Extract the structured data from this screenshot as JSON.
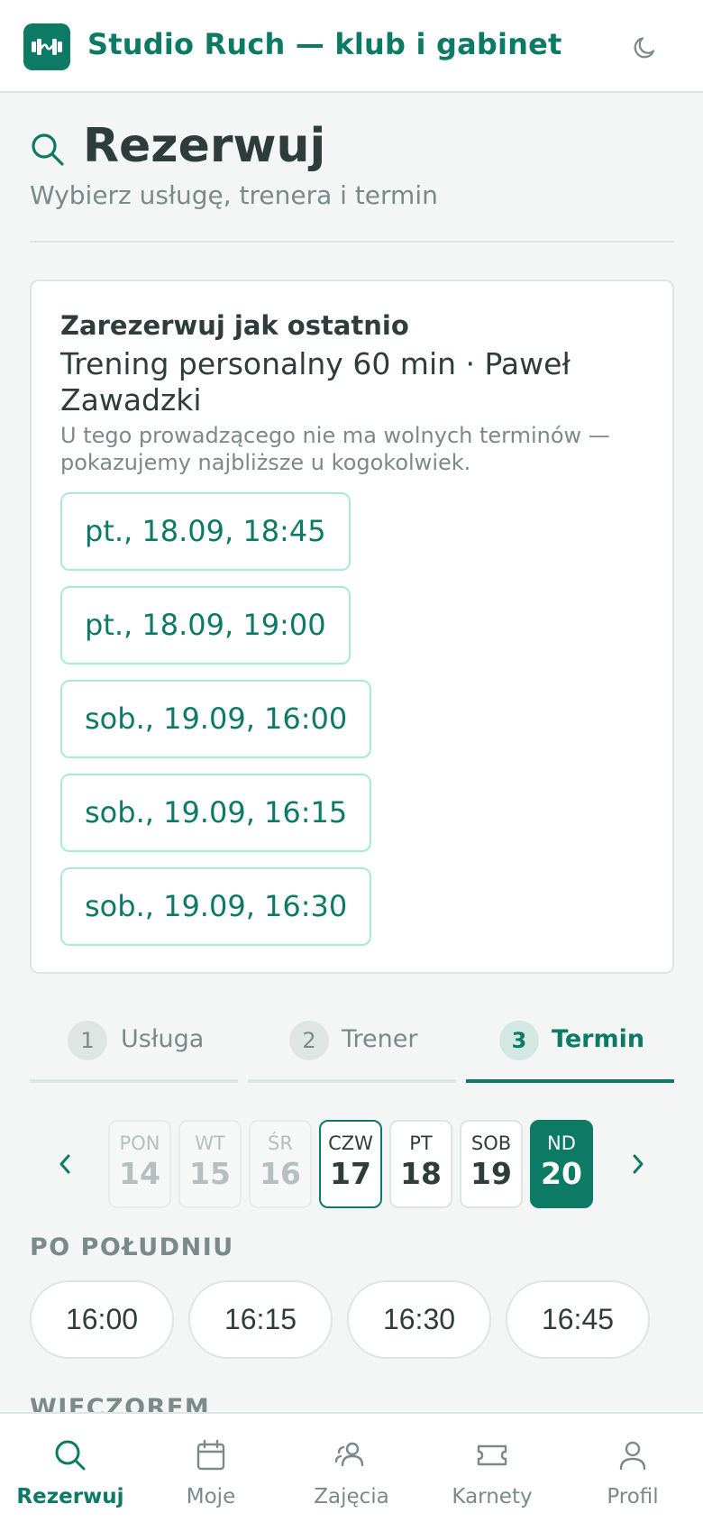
{
  "header": {
    "app_title": "Studio Ruch — klub i gabinet",
    "logo_icon": "dumbbell-icon",
    "theme_toggle_icon": "moon-icon"
  },
  "page": {
    "title": "Rezerwuj",
    "subtitle": "Wybierz usługę, trenera i termin"
  },
  "rebook_card": {
    "title": "Zarezerwuj jak ostatnio",
    "service": "Trening personalny 60 min · Paweł Zawadzki",
    "note": "U tego prowadzącego nie ma wolnych terminów — pokazujemy najbliższe u kogokolwiek.",
    "slots": [
      "pt., 18.09, 18:45",
      "pt., 18.09, 19:00",
      "sob., 19.09, 16:00",
      "sob., 19.09, 16:15",
      "sob., 19.09, 16:30"
    ]
  },
  "steps": [
    {
      "num": "1",
      "label": "Usługa"
    },
    {
      "num": "2",
      "label": "Trener"
    },
    {
      "num": "3",
      "label": "Termin"
    }
  ],
  "active_step": 3,
  "days": [
    {
      "dow": "PON",
      "num": "14",
      "state": "disabled"
    },
    {
      "dow": "WT",
      "num": "15",
      "state": "disabled"
    },
    {
      "dow": "ŚR",
      "num": "16",
      "state": "disabled"
    },
    {
      "dow": "CZW",
      "num": "17",
      "state": "today"
    },
    {
      "dow": "PT",
      "num": "18",
      "state": "normal"
    },
    {
      "dow": "SOB",
      "num": "19",
      "state": "normal"
    },
    {
      "dow": "ND",
      "num": "20",
      "state": "selected"
    }
  ],
  "periods": {
    "afternoon": {
      "label": "PO POŁUDNIU",
      "times": [
        "16:00",
        "16:15",
        "16:30",
        "16:45"
      ]
    },
    "evening": {
      "label": "WIECZOREM"
    }
  },
  "bottom_nav": [
    {
      "label": "Rezerwuj",
      "icon": "search-icon",
      "active": true
    },
    {
      "label": "Moje",
      "icon": "calendar-icon",
      "active": false
    },
    {
      "label": "Zajęcia",
      "icon": "group-icon",
      "active": false
    },
    {
      "label": "Karnety",
      "icon": "ticket-icon",
      "active": false
    },
    {
      "label": "Profil",
      "icon": "user-icon",
      "active": false
    }
  ],
  "colors": {
    "accent": "#0d7a65",
    "slot_border": "#a8ead6",
    "muted_text": "#7a8a87",
    "background": "#f3f6f5"
  }
}
